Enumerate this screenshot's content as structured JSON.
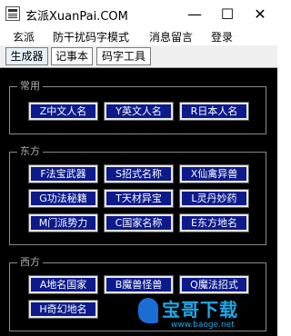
{
  "window": {
    "title": "玄派XuanPai.COM",
    "minimize_symbol": "—",
    "maximize_symbol": "☐",
    "close_symbol": "✕"
  },
  "menu": {
    "items": [
      "玄派",
      "防干扰码字模式",
      "消息留言",
      "登录"
    ]
  },
  "tabs": [
    {
      "label": "生成器",
      "active": true
    },
    {
      "label": "记事本",
      "active": false
    },
    {
      "label": "码字工具",
      "active": false
    }
  ],
  "groups": [
    {
      "title": "常用",
      "buttons": [
        "Z中文人名",
        "Y英文人名",
        "R日本人名"
      ]
    },
    {
      "title": "东方",
      "buttons": [
        "F法宝武器",
        "S招式名称",
        "X仙禽异兽",
        "G功法秘籍",
        "T天材异宝",
        "L灵丹妙药",
        "M门派势力",
        "C国家名称",
        "E东方地名"
      ]
    },
    {
      "title": "西方",
      "buttons": [
        "A地名国家",
        "B魔兽怪兽",
        "Q魔法招式",
        "H奇幻地名"
      ]
    }
  ],
  "watermark": {
    "text": "宝哥下载",
    "url": "www.baoge.net"
  },
  "colors": {
    "button_bg": "#0d1a8c",
    "panel_bg": "#000000",
    "watermark": "#1fa8e8"
  }
}
